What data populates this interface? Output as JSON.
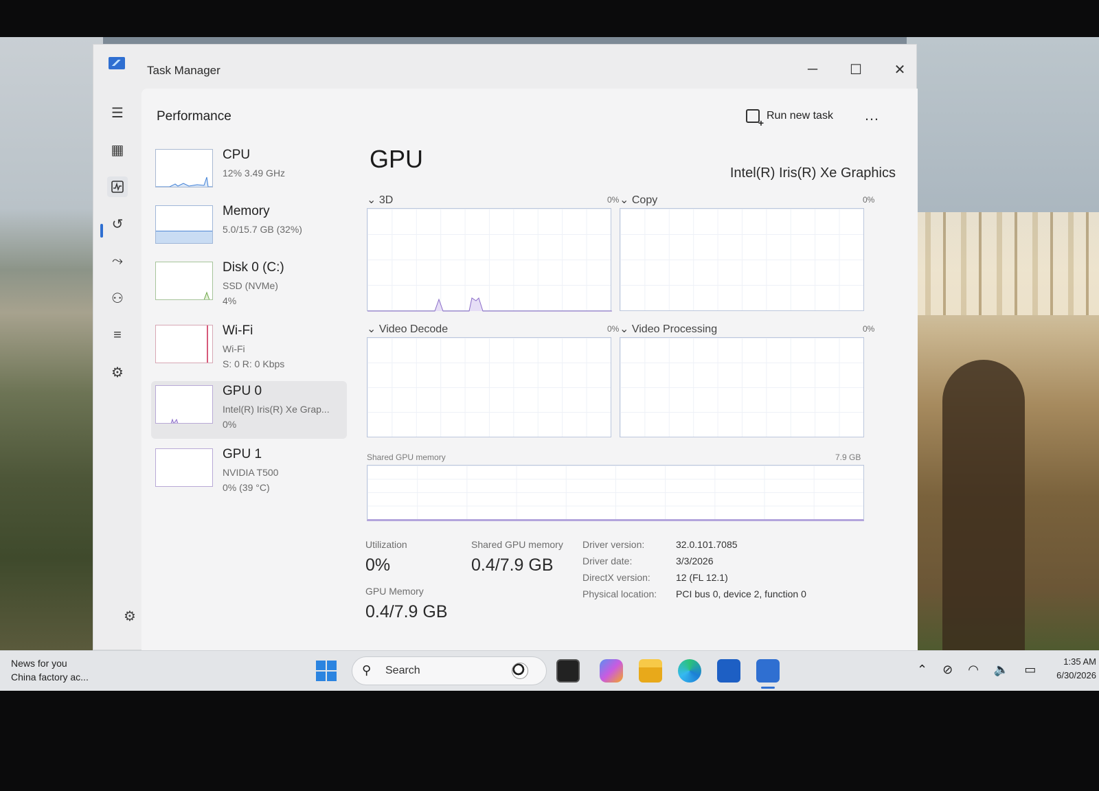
{
  "window": {
    "title": "Task Manager"
  },
  "toolbar": {
    "page_title": "Performance",
    "run_new_task": "Run new task",
    "more": "…"
  },
  "resources": [
    {
      "name": "CPU",
      "line1": "12%  3.49 GHz",
      "line2": ""
    },
    {
      "name": "Memory",
      "line1": "5.0/15.7 GB (32%)",
      "line2": ""
    },
    {
      "name": "Disk 0 (C:)",
      "line1": "SSD (NVMe)",
      "line2": "4%"
    },
    {
      "name": "Wi-Fi",
      "line1": "Wi-Fi",
      "line2": "S: 0  R: 0 Kbps"
    },
    {
      "name": "GPU 0",
      "line1": "Intel(R) Iris(R) Xe Grap...",
      "line2": "0%"
    },
    {
      "name": "GPU 1",
      "line1": "NVIDIA T500",
      "line2": "0% (39 °C)"
    }
  ],
  "gpu": {
    "title": "GPU",
    "model": "Intel(R) Iris(R) Xe Graphics",
    "engines": [
      {
        "label": "3D",
        "pct": "0%"
      },
      {
        "label": "Copy",
        "pct": "0%"
      },
      {
        "label": "Video Decode",
        "pct": "0%"
      },
      {
        "label": "Video Processing",
        "pct": "0%"
      }
    ],
    "shared_mem_label": "Shared GPU memory",
    "shared_mem_max": "7.9 GB",
    "stats": {
      "utilization_label": "Utilization",
      "utilization": "0%",
      "shared_label": "Shared GPU memory",
      "shared": "0.4/7.9 GB",
      "gpu_memory_label": "GPU Memory",
      "gpu_memory": "0.4/7.9 GB"
    },
    "info": {
      "driver_version_k": "Driver version:",
      "driver_version": "32.0.101.7085",
      "driver_date_k": "Driver date:",
      "driver_date": "3/3/2026",
      "directx_k": "DirectX version:",
      "directx": "12 (FL 12.1)",
      "location_k": "Physical location:",
      "location": "PCI bus 0, device 2, function 0"
    }
  },
  "taskbar": {
    "news_title": "News for you",
    "news_sub": "China factory ac...",
    "search_placeholder": "Search",
    "time": "1:35 AM",
    "date": "6/30/2026"
  },
  "colors": {
    "accent": "#2f6fd1",
    "window_bg": "#ededee",
    "graph_border": "#bcc7dd"
  },
  "icons": [
    "hamburger-icon",
    "processes-icon",
    "performance-icon",
    "app-history-icon",
    "startup-icon",
    "users-icon",
    "details-icon",
    "services-icon",
    "settings-icon"
  ]
}
